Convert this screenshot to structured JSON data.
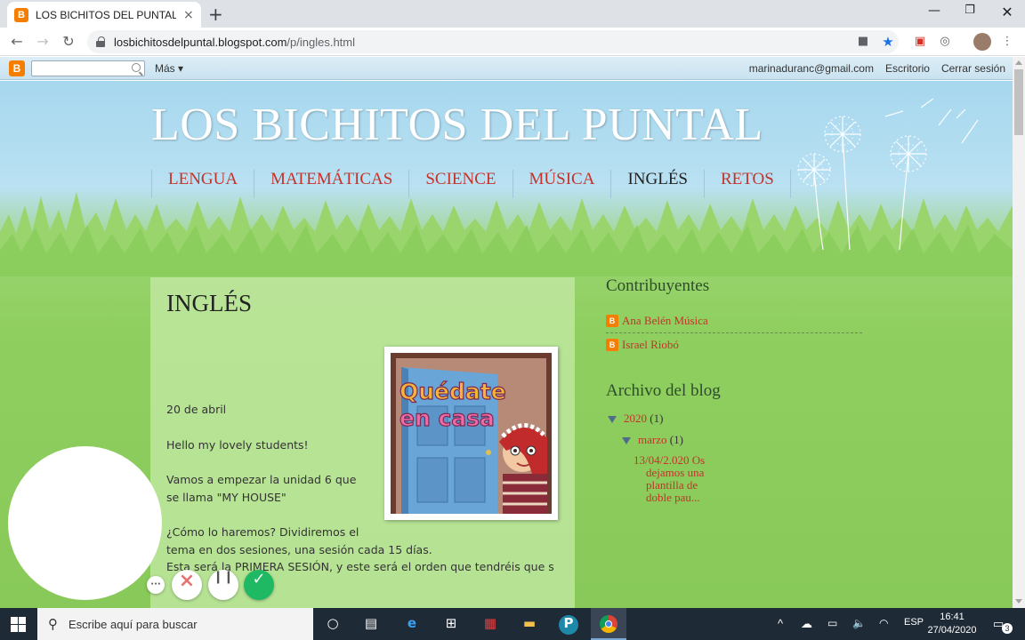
{
  "browser": {
    "tab_title": "LOS BICHITOS DEL PUNTAL: INGLÉS",
    "tab_favicon": "B",
    "url_domain": "losbichitosdelpuntal.blogspot.com",
    "url_path": "/p/ingles.html",
    "new_tab_icon": "+",
    "close_icon": "×"
  },
  "blogger_bar": {
    "logo": "B",
    "more_label": "Más ▾",
    "user_email": "marinaduranc@gmail.com",
    "desk_label": "Escritorio",
    "logout_label": "Cerrar sesión"
  },
  "blog": {
    "title": "LOS BICHITOS DEL PUNTAL",
    "nav": [
      "LENGUA",
      "MATEMÁTICAS",
      "SCIENCE",
      "MÚSICA",
      "INGLÉS",
      "RETOS"
    ],
    "active_nav": "INGLÉS"
  },
  "post": {
    "title": "INGLÉS",
    "image_text_1": "Quédate",
    "image_text_2": "en casa",
    "date": "20 de abril",
    "greeting": "Hello my lovely students!",
    "para1": "Vamos a empezar la unidad 6 que se llama \"MY HOUSE\"",
    "para2_line1": "¿Cómo lo haremos? Dividiremos el",
    "para2_line2": "tema en dos sesiones, una sesión cada 15 días.",
    "para3": "Esta será la PRIMERA SESIÓN, y este será el orden que tendréis que s"
  },
  "sidebar": {
    "contrib_title": "Contribuyentes",
    "contributors": [
      "Ana Belén Música",
      "Israel Riobó"
    ],
    "archive_title": "Archivo del blog",
    "year": "2020",
    "year_count": "(1)",
    "month": "marzo",
    "month_count": "(1)",
    "entry_line1": "13/04/2.020 Os",
    "entry_line2": "dejamos una",
    "entry_line3": "plantilla de",
    "entry_line4": "doble pau..."
  },
  "recording": {
    "more_icon": "···",
    "cancel_icon": "×",
    "pause_icon": "❙❙",
    "done_icon": "✓"
  },
  "taskbar": {
    "search_placeholder": "Escribe aquí para buscar",
    "lang": "ESP",
    "time": "16:41",
    "date": "27/04/2020",
    "notif_count": "3"
  },
  "colors": {
    "link_red": "#c4332a",
    "blogger_orange": "#f57d00",
    "taskbar": "#1f2a37"
  }
}
